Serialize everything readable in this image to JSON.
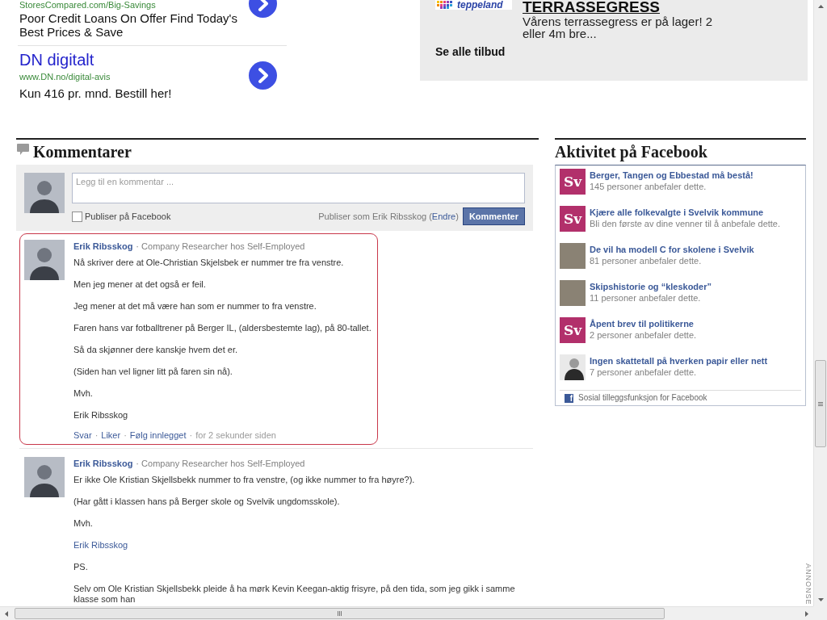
{
  "ads": [
    {
      "url": "StoresCompared.com/Big-Savings",
      "text": "Poor Credit Loans On Offer Find Today's Best Prices & Save"
    },
    {
      "title": "DN digitalt",
      "url": "www.DN.no/digital-avis",
      "text": "Kun 416 pr. mnd. Bestill her!"
    }
  ],
  "promo": {
    "logo": "teppeland",
    "title": "TERRASSEGRESS",
    "text": "Vårens terrassegress er på lager! 2 eller 4m bre...",
    "link": "Se alle tilbud"
  },
  "comments_section": {
    "title": "Kommentarer",
    "composer": {
      "placeholder": "Legg til en kommentar ...",
      "share": {
        "label": "Publiser på Facebook",
        "checked": false
      },
      "publish_as": {
        "prefix": "Publiser som Erik Ribsskog (",
        "link": "Endre",
        "suffix": ")"
      },
      "submit": "Kommenter"
    },
    "comments": [
      {
        "author": "Erik Ribsskog",
        "headline": "· Company Researcher hos Self-Employed",
        "highlighted": true,
        "paragraphs": [
          {
            "kind": "text",
            "text": "Nå skriver dere at Ole-Christian Skjelsbek er nummer tre fra venstre."
          },
          {
            "kind": "text",
            "text": "Men jeg mener at det også er feil."
          },
          {
            "kind": "text",
            "text": "Jeg mener at det må være han som er nummer to fra venstre."
          },
          {
            "kind": "text",
            "text": "Faren hans var fotballtrener på Berger IL, (aldersbestemte lag), på 80-tallet."
          },
          {
            "kind": "text",
            "text": "Så da skjønner dere kanskje hvem det er."
          },
          {
            "kind": "text",
            "text": "(Siden han vel ligner litt på faren sin nå)."
          },
          {
            "kind": "text",
            "text": "Mvh."
          },
          {
            "kind": "text",
            "text": "Erik Ribsskog"
          }
        ],
        "actions": [
          {
            "kind": "link",
            "text": "Svar"
          },
          {
            "kind": "separator",
            "text": "·"
          },
          {
            "kind": "link",
            "text": "Liker"
          },
          {
            "kind": "separator",
            "text": "·"
          },
          {
            "kind": "link",
            "text": "Følg innlegget"
          },
          {
            "kind": "separator",
            "text": "·"
          },
          {
            "kind": "time",
            "text": "for 2 sekunder siden"
          }
        ]
      },
      {
        "author": "Erik Ribsskog",
        "headline": "· Company Researcher hos Self-Employed",
        "highlighted": false,
        "paragraphs": [
          {
            "kind": "text",
            "text": "Er ikke Ole Kristian Skjellsbekk nummer to fra venstre, (og ikke nummer to fra høyre?)."
          },
          {
            "kind": "text",
            "text": "(Har gått i klassen hans på Berger skole og Svelvik ungdomsskole)."
          },
          {
            "kind": "text",
            "text": "Mvh."
          },
          {
            "kind": "link",
            "text": "Erik Ribsskog"
          },
          {
            "kind": "text",
            "text": "PS."
          },
          {
            "kind": "text",
            "text": "Selv om Ole Kristian Skjellsbekk pleide å ha mørk Kevin Keegan-aktig frisyre, på den tida, som jeg gikk i samme klasse som han"
          }
        ]
      }
    ]
  },
  "sidebar": {
    "title": "Aktivitet på Facebook",
    "items": [
      {
        "kind": "logo",
        "logo_text": "Sv",
        "title": "Berger, Tangen og Ebbestad må bestå!",
        "subtitle": "145 personer anbefaler dette."
      },
      {
        "kind": "logo",
        "logo_text": "Sv",
        "title": "Kjære alle folkevalgte i Svelvik kommune",
        "subtitle": "Bli den første av dine venner til å anbefale dette."
      },
      {
        "kind": "photo",
        "title": "De vil ha modell C for skolene i Svelvik",
        "subtitle": "81 personer anbefaler dette."
      },
      {
        "kind": "photo",
        "title": "Skipshistorie og “kleskoder”",
        "subtitle": "11 personer anbefaler dette."
      },
      {
        "kind": "logo",
        "logo_text": "Sv",
        "title": "Åpent brev til politikerne",
        "subtitle": "2 personer anbefaler dette."
      },
      {
        "kind": "portrait",
        "title": "Ingen skattetall på hverken papir eller nett",
        "subtitle": "7 personer anbefaler dette."
      }
    ],
    "footer": {
      "icon": "f",
      "text": "Sosial tilleggsfunksjon for Facebook"
    }
  },
  "ad_label": "ANNONSE"
}
